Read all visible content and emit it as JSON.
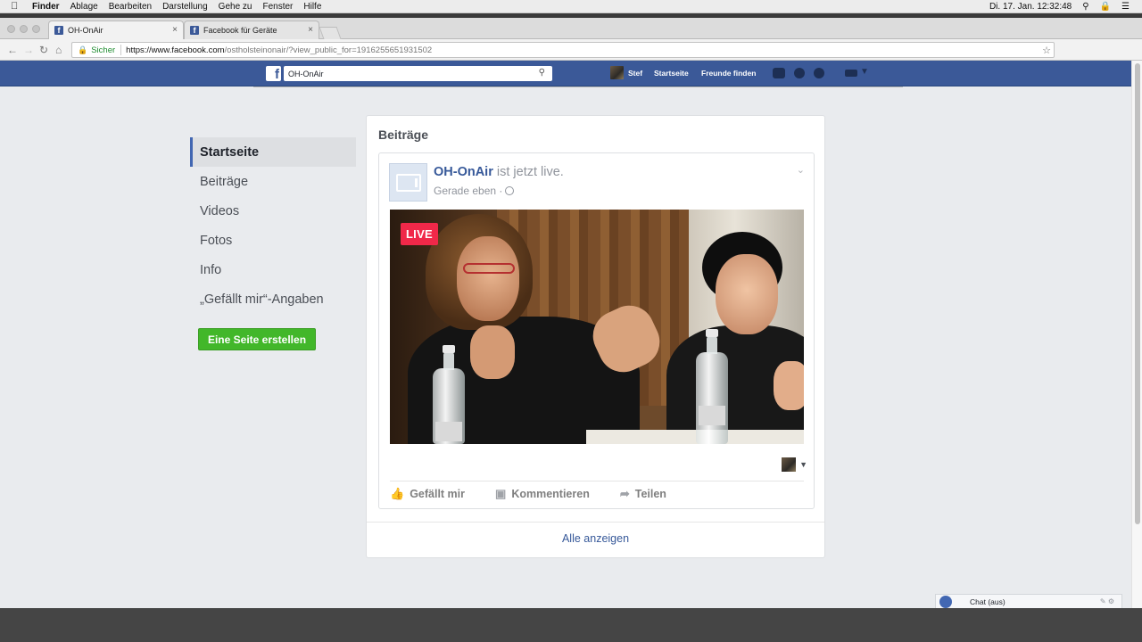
{
  "menubar": {
    "apple": "",
    "app": "Finder",
    "items": [
      "Ablage",
      "Bearbeiten",
      "Darstellung",
      "Gehe zu",
      "Fenster",
      "Hilfe"
    ],
    "clock": "Di. 17. Jan.  12:32:48"
  },
  "tabs": [
    {
      "title": "OH-OnAir",
      "close": "×"
    },
    {
      "title": "Facebook für Geräte",
      "close": "×"
    }
  ],
  "address": {
    "secure_label": "Sicher",
    "url_host": "https://www.facebook.com",
    "url_path": "/ostholsteinonair/?view_public_for=1916255651931502"
  },
  "fb": {
    "logo": "f",
    "search_value": "OH-OnAir",
    "user_name": "Stef",
    "links": [
      "Startseite",
      "Freunde finden"
    ]
  },
  "leftnav": {
    "items": [
      "Startseite",
      "Beiträge",
      "Videos",
      "Fotos",
      "Info",
      "„Gefällt mir“-Angaben"
    ],
    "create_page": "Eine Seite erstellen"
  },
  "card": {
    "title": "Beiträge",
    "post": {
      "page_name": "OH-OnAir",
      "status": " ist jetzt live.",
      "time": "Gerade eben ·",
      "live_badge": "LIVE",
      "actions": [
        "Gefällt mir",
        "Kommentieren",
        "Teilen"
      ]
    },
    "see_all": "Alle anzeigen"
  },
  "chat": {
    "label": "Chat (aus)"
  },
  "colors": {
    "fb_blue": "#3b5998",
    "create_green": "#42b72a",
    "live_red": "#f02849",
    "link_blue": "#365899"
  }
}
